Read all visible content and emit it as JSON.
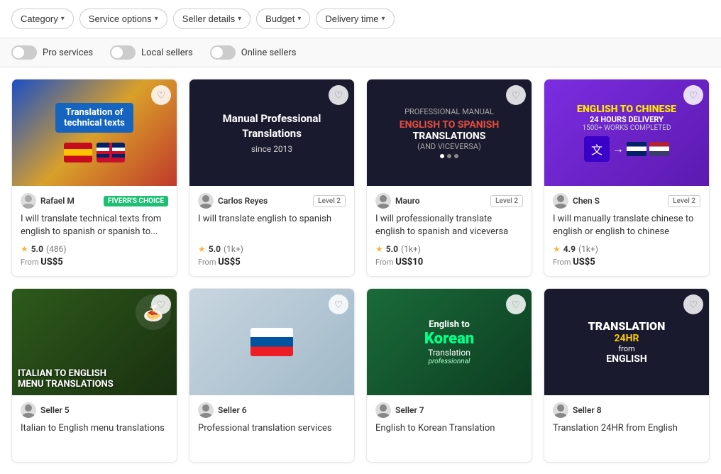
{
  "filters": [
    {
      "id": "category",
      "label": "Category"
    },
    {
      "id": "service-options",
      "label": "Service options"
    },
    {
      "id": "seller-details",
      "label": "Seller details"
    },
    {
      "id": "budget",
      "label": "Budget"
    },
    {
      "id": "delivery-time",
      "label": "Delivery time"
    }
  ],
  "toggles": [
    {
      "id": "pro-services",
      "label": "Pro services",
      "enabled": false
    },
    {
      "id": "local-sellers",
      "label": "Local sellers",
      "enabled": false
    },
    {
      "id": "online-sellers",
      "label": "Online sellers",
      "enabled": false
    }
  ],
  "cards": [
    {
      "id": "card-1",
      "sellerName": "Rafael M",
      "badgeType": "fiverr",
      "badgeLabel": "FIVERR'S CHOICE",
      "levelLabel": "",
      "title": "I will translate technical texts from english to spanish or spanish to...",
      "rating": "5.0",
      "ratingCount": "(486)",
      "price": "From US$5",
      "imageType": "bg1"
    },
    {
      "id": "card-2",
      "sellerName": "Carlos Reyes",
      "badgeType": "level",
      "badgeLabel": "Level 2",
      "title": "I will translate english to spanish",
      "rating": "5.0",
      "ratingCount": "(1k+)",
      "price": "From US$5",
      "imageType": "bg2"
    },
    {
      "id": "card-3",
      "sellerName": "Mauro",
      "badgeType": "level",
      "badgeLabel": "Level 2",
      "title": "I will professionally translate english to spanish and viceversa",
      "rating": "5.0",
      "ratingCount": "(1k+)",
      "price": "From US$10",
      "imageType": "bg3"
    },
    {
      "id": "card-4",
      "sellerName": "Chen S",
      "badgeType": "level",
      "badgeLabel": "Level 2",
      "title": "I will manually translate chinese to english or english to chinese",
      "rating": "4.9",
      "ratingCount": "(1k+)",
      "price": "From US$5",
      "imageType": "bg4"
    },
    {
      "id": "card-5",
      "sellerName": "Seller 5",
      "badgeType": "level",
      "badgeLabel": "",
      "title": "Italian to English menu translations",
      "rating": "",
      "ratingCount": "",
      "price": "",
      "imageType": "bg5"
    },
    {
      "id": "card-6",
      "sellerName": "Seller 6",
      "badgeType": "level",
      "badgeLabel": "",
      "title": "Professional translation services",
      "rating": "",
      "ratingCount": "",
      "price": "",
      "imageType": "bg6"
    },
    {
      "id": "card-7",
      "sellerName": "Seller 7",
      "badgeType": "level",
      "badgeLabel": "",
      "title": "English to Korean Translation",
      "rating": "",
      "ratingCount": "",
      "price": "",
      "imageType": "bg7"
    },
    {
      "id": "card-8",
      "sellerName": "Seller 8",
      "badgeType": "level",
      "badgeLabel": "",
      "title": "Translation 24HR from English",
      "rating": "",
      "ratingCount": "",
      "price": "",
      "imageType": "bg8"
    }
  ],
  "icons": {
    "heart": "♡",
    "star": "★",
    "chevron": "▾"
  }
}
